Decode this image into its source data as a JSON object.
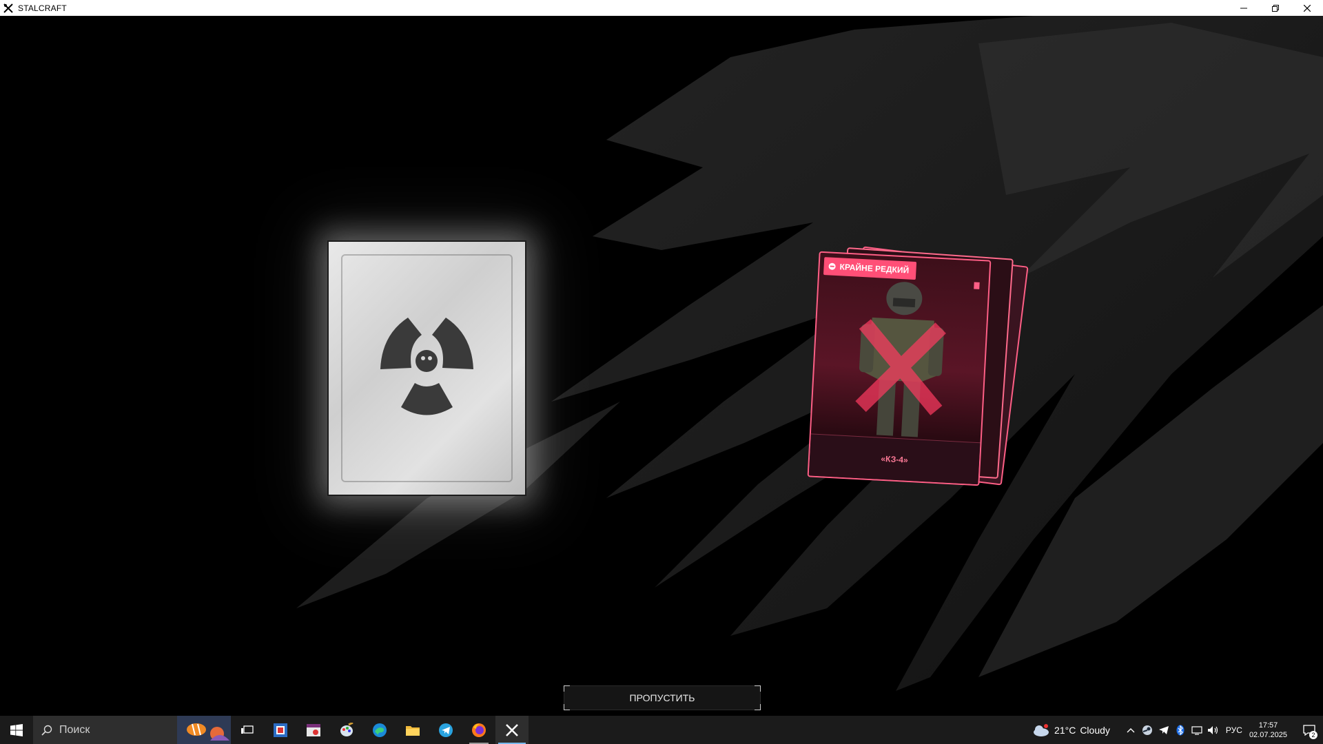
{
  "window": {
    "title": "STALCRAFT",
    "controls": {
      "minimize": "minimize",
      "restore": "restore",
      "close": "close"
    }
  },
  "reward_screen": {
    "card_back": {
      "symbol": "radiation-symbol"
    },
    "reward_card": {
      "rarity": "КРАЙНЕ РЕДКИЙ",
      "name": "«КЗ-4»",
      "accent_color": "#ff5f86"
    },
    "skip_button": {
      "label": "ПРОПУСТИТЬ"
    }
  },
  "taskbar": {
    "search_placeholder": "Поиск",
    "pinned_apps": [
      "start-icon",
      "task-view-icon",
      "app-icon",
      "calendar-app-icon",
      "paint-icon",
      "edge-icon",
      "file-explorer-icon",
      "telegram-icon",
      "firefox-icon",
      "stalcraft-icon"
    ],
    "weather": {
      "temperature": "21°C",
      "condition": "Cloudy"
    },
    "language": "РУС",
    "time": "17:57",
    "date": "02.07.2025",
    "notifications_count": "2"
  }
}
